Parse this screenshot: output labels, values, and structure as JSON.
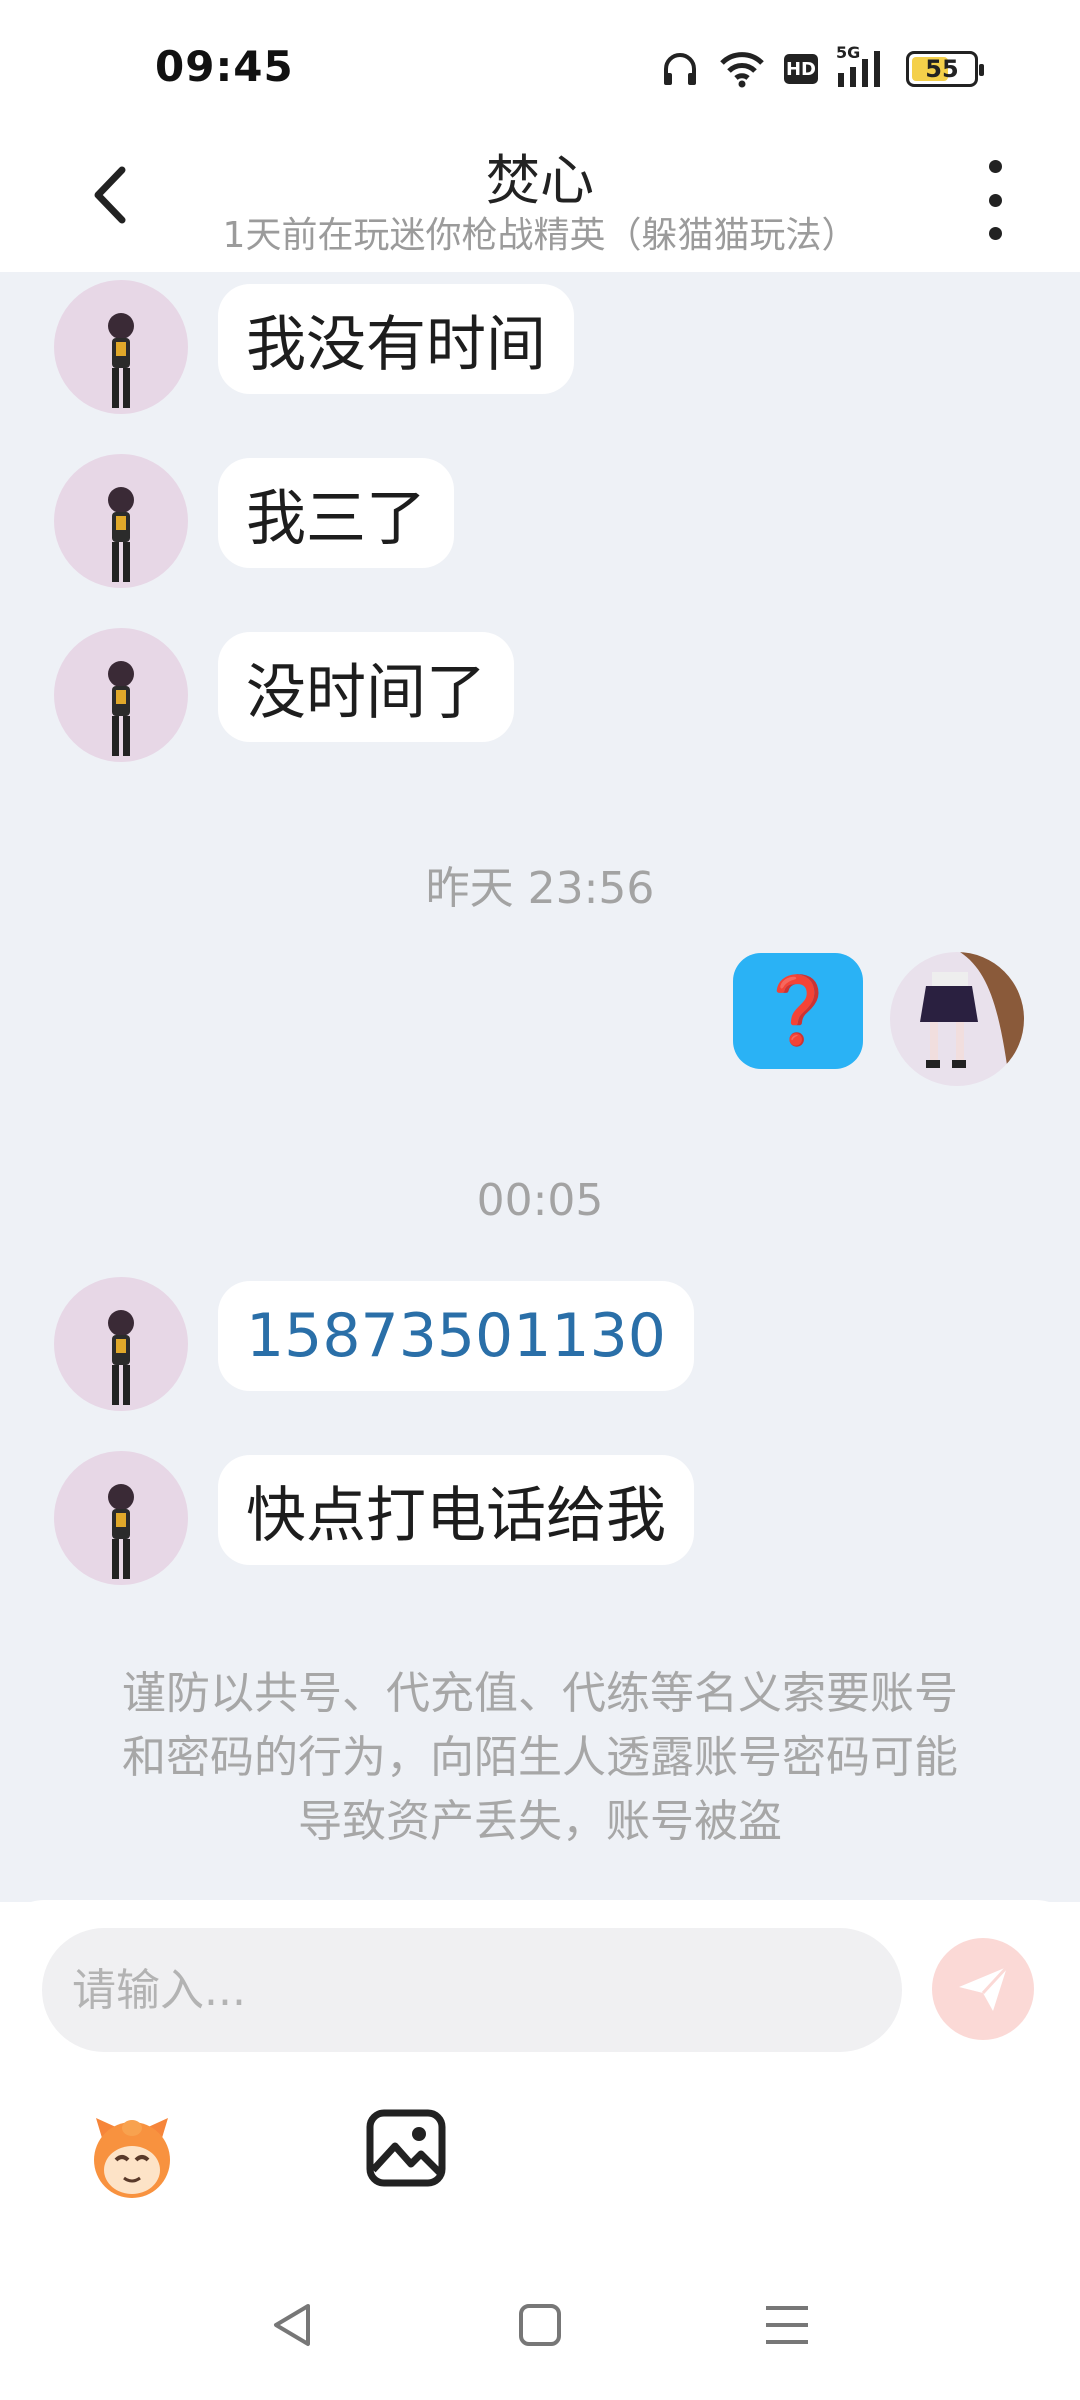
{
  "status_bar": {
    "time": "09:45",
    "network": "5G",
    "hd": "HD",
    "battery": "55"
  },
  "header": {
    "title": "焚心",
    "subtitle": "1天前在玩迷你枪战精英（躲猫猫玩法）"
  },
  "messages": [
    {
      "side": "left",
      "text": "我没有时间"
    },
    {
      "side": "left",
      "text": "我三了"
    },
    {
      "side": "left",
      "text": "没时间了"
    },
    {
      "type": "timestamp",
      "text": "昨天 23:56"
    },
    {
      "side": "right",
      "text": "❓"
    },
    {
      "type": "timestamp",
      "text": "00:05"
    },
    {
      "side": "left",
      "text": "15873501130",
      "link": true
    },
    {
      "side": "left",
      "text": "快点打电话给我"
    }
  ],
  "notice": "谨防以共号、代充值、代练等名义索要账号和密码的行为，向陌生人透露账号密码可能导致资产丢失，账号被盗",
  "input": {
    "placeholder": "请输入..."
  },
  "colors": {
    "accent": "#2ab2f5",
    "chat_bg": "#eef1f6",
    "link": "#2a6fa8",
    "send_disabled": "#fbd9d6"
  }
}
